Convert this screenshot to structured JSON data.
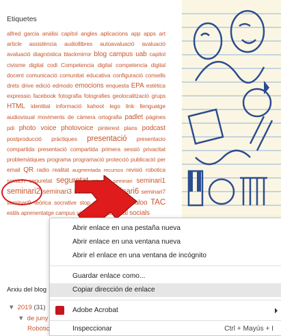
{
  "sidebar": {
    "title": "Etiquetes",
    "tags": [
      {
        "t": "alfred garcia",
        "c": ""
      },
      {
        "t": "anàlisi",
        "c": ""
      },
      {
        "t": "capítol",
        "c": ""
      },
      {
        "t": "angles",
        "c": ""
      },
      {
        "t": "aplicacions",
        "c": ""
      },
      {
        "t": "app",
        "c": ""
      },
      {
        "t": "apps",
        "c": ""
      },
      {
        "t": "art",
        "c": ""
      },
      {
        "t": "article",
        "c": ""
      },
      {
        "t": "assistència",
        "c": ""
      },
      {
        "t": "audiollibres",
        "c": ""
      },
      {
        "t": "autoavaluació",
        "c": ""
      },
      {
        "t": "avaluació",
        "c": ""
      },
      {
        "t": "avaluació",
        "c": ""
      },
      {
        "t": "diagnòstica",
        "c": ""
      },
      {
        "t": "blackmirror",
        "c": ""
      },
      {
        "t": "blog",
        "c": "m"
      },
      {
        "t": "campus uab",
        "c": "m"
      },
      {
        "t": "capitol",
        "c": ""
      },
      {
        "t": "civisme",
        "c": ""
      },
      {
        "t": "digital",
        "c": ""
      },
      {
        "t": "codi",
        "c": ""
      },
      {
        "t": "Competencia",
        "c": ""
      },
      {
        "t": "digital",
        "c": ""
      },
      {
        "t": "competencia",
        "c": ""
      },
      {
        "t": "digital",
        "c": ""
      },
      {
        "t": "docent",
        "c": ""
      },
      {
        "t": "comunicació",
        "c": ""
      },
      {
        "t": "comunitat",
        "c": ""
      },
      {
        "t": "educativa",
        "c": ""
      },
      {
        "t": "configuració",
        "c": ""
      },
      {
        "t": "consells",
        "c": ""
      },
      {
        "t": "drets",
        "c": ""
      },
      {
        "t": "drive",
        "c": ""
      },
      {
        "t": "edició",
        "c": ""
      },
      {
        "t": "edmodo",
        "c": ""
      },
      {
        "t": "emocions",
        "c": "m"
      },
      {
        "t": "enquesta",
        "c": ""
      },
      {
        "t": "EPA",
        "c": "m"
      },
      {
        "t": "estètica",
        "c": ""
      },
      {
        "t": "expressio",
        "c": ""
      },
      {
        "t": "facebook",
        "c": ""
      },
      {
        "t": "fotografia",
        "c": ""
      },
      {
        "t": "fotografies",
        "c": ""
      },
      {
        "t": "geolocalització",
        "c": ""
      },
      {
        "t": "grups",
        "c": ""
      },
      {
        "t": "HTML",
        "c": "m"
      },
      {
        "t": "identitat",
        "c": ""
      },
      {
        "t": "informació",
        "c": ""
      },
      {
        "t": "kahoot",
        "c": ""
      },
      {
        "t": "lego",
        "c": ""
      },
      {
        "t": "link",
        "c": ""
      },
      {
        "t": "llenguatge",
        "c": ""
      },
      {
        "t": "audiovisual",
        "c": ""
      },
      {
        "t": "moviments",
        "c": ""
      },
      {
        "t": "de",
        "c": ""
      },
      {
        "t": "càmera",
        "c": ""
      },
      {
        "t": "ortografia",
        "c": ""
      },
      {
        "t": "padlet",
        "c": "m"
      },
      {
        "t": "pàgines",
        "c": ""
      },
      {
        "t": "pdi",
        "c": ""
      },
      {
        "t": "photo voice",
        "c": "m"
      },
      {
        "t": "photovoice",
        "c": "m"
      },
      {
        "t": "pinterest",
        "c": ""
      },
      {
        "t": "plans",
        "c": ""
      },
      {
        "t": "podcast",
        "c": "m"
      },
      {
        "t": "postproducció",
        "c": ""
      },
      {
        "t": "pràctiques",
        "c": ""
      },
      {
        "t": "presentació",
        "c": "l"
      },
      {
        "t": "presentacio",
        "c": ""
      },
      {
        "t": "compartida",
        "c": ""
      },
      {
        "t": "presentació",
        "c": ""
      },
      {
        "t": "compartida",
        "c": ""
      },
      {
        "t": "primera",
        "c": ""
      },
      {
        "t": "sessió",
        "c": ""
      },
      {
        "t": "privacitat",
        "c": ""
      },
      {
        "t": "problemàtiques",
        "c": ""
      },
      {
        "t": "programa",
        "c": ""
      },
      {
        "t": "programació",
        "c": ""
      },
      {
        "t": "protecció",
        "c": ""
      },
      {
        "t": "publicació",
        "c": ""
      },
      {
        "t": "per",
        "c": ""
      },
      {
        "t": "email",
        "c": ""
      },
      {
        "t": "QR",
        "c": "m"
      },
      {
        "t": "radio",
        "c": ""
      },
      {
        "t": "realitat",
        "c": ""
      },
      {
        "t": "augmentada",
        "c": "s"
      },
      {
        "t": "recursos",
        "c": "s"
      },
      {
        "t": "revisió",
        "c": ""
      },
      {
        "t": "robotica",
        "c": ""
      },
      {
        "t": "scratch",
        "c": ""
      },
      {
        "t": "seguretat",
        "c": ""
      },
      {
        "t": "seguretat",
        "c": "l"
      },
      {
        "t": "internet",
        "c": "s"
      },
      {
        "t": "seminari",
        "c": "s"
      },
      {
        "t": "seminari1",
        "c": "m"
      },
      {
        "t": "seminari2",
        "c": "l"
      },
      {
        "t": "seminari3",
        "c": "m"
      },
      {
        "t": "seminari5",
        "c": "m"
      },
      {
        "t": "seminari6",
        "c": "l"
      },
      {
        "t": "seminari7",
        "c": ""
      },
      {
        "t": "seminari9",
        "c": ""
      },
      {
        "t": "teórica",
        "c": ""
      },
      {
        "t": "socrative",
        "c": ""
      },
      {
        "t": "stop",
        "c": ""
      },
      {
        "t": "motion",
        "c": ""
      },
      {
        "t": "symbolaloo",
        "c": "m"
      },
      {
        "t": "TAC",
        "c": "l"
      },
      {
        "t": "estils",
        "c": ""
      },
      {
        "t": "aprenentatge",
        "c": ""
      },
      {
        "t": "campus",
        "c": ""
      },
      {
        "t": "vídeo",
        "c": ""
      },
      {
        "t": "videotutorial",
        "c": "m"
      },
      {
        "t": "socials",
        "c": "m"
      }
    ],
    "archive_title": "Arxiu del blog",
    "archive_year": "2019",
    "archive_year_count": "(31)",
    "archive_month": "de juny",
    "archive_post": "Robòtica"
  },
  "context_menu": {
    "items": [
      {
        "label": "Abrir enlace en una pestaña nueva",
        "shortcut": ""
      },
      {
        "label": "Abrir enlace en una ventana nueva",
        "shortcut": ""
      },
      {
        "label": "Abrir el enlace en una ventana de incógnito",
        "shortcut": ""
      },
      {
        "label": "Guardar enlace como...",
        "shortcut": ""
      },
      {
        "label": "Copiar dirección de enlace",
        "shortcut": ""
      },
      {
        "label": "Adobe Acrobat",
        "shortcut": ""
      },
      {
        "label": "Inspeccionar",
        "shortcut": "Ctrl + Mayús + I"
      }
    ]
  },
  "colors": {
    "tag": "#c8552b",
    "highlight": "#d11a1a",
    "menu_hover": "#e6e6e6"
  }
}
